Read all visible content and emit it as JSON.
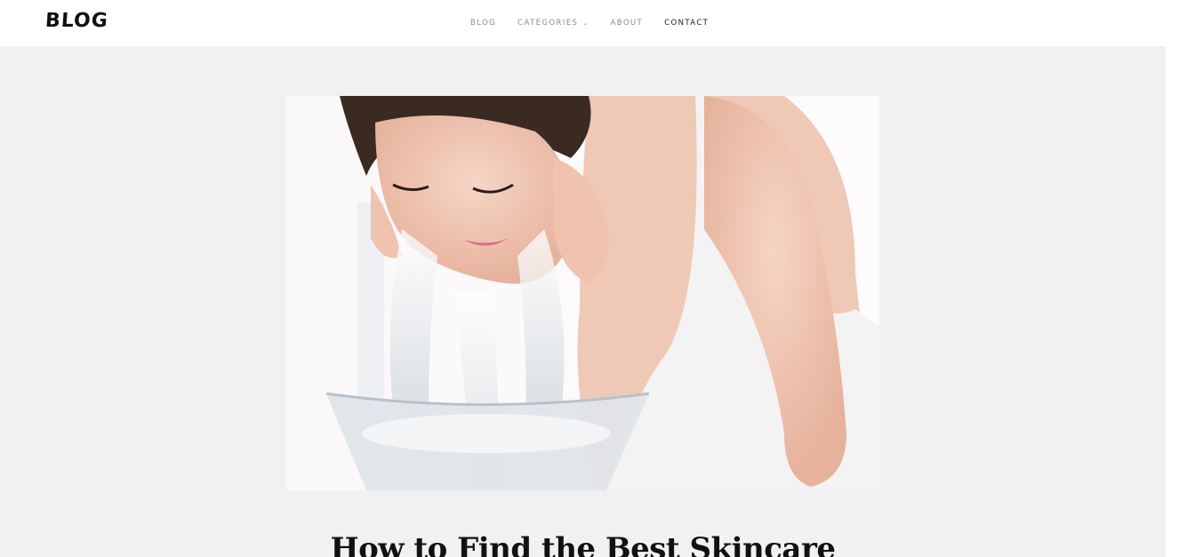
{
  "header": {
    "logo": "BLOG",
    "nav": [
      {
        "label": "BLOG",
        "active": false
      },
      {
        "label": "CATEGORIES",
        "active": false,
        "dropdown": true
      },
      {
        "label": "ABOUT",
        "active": false
      },
      {
        "label": "CONTACT",
        "active": true
      }
    ],
    "dropdown_icon": "chevron-down-icon"
  },
  "post": {
    "image": "woman splashing water on face over glass bowl",
    "title": "How to Find the Best Skincare"
  },
  "colors": {
    "page_bg": "#f1f1f1",
    "header_bg": "#ffffff",
    "nav_text": "#8a8a8a",
    "nav_active": "#1a1a1a"
  }
}
